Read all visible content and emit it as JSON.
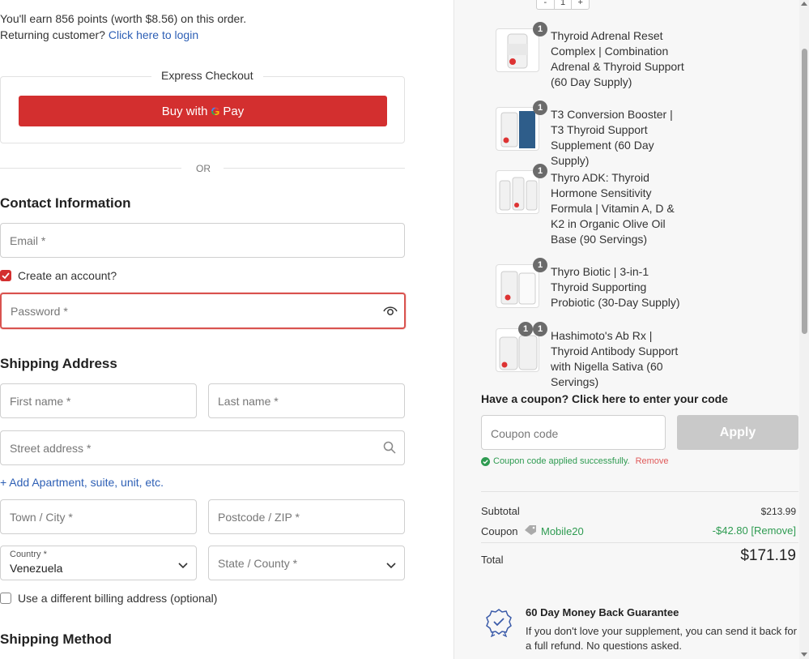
{
  "notices": {
    "points": "You'll earn 856 points (worth $8.56) on this order.",
    "returning_prefix": "Returning customer?",
    "login_link": "Click here to login"
  },
  "express": {
    "title": "Express Checkout",
    "button_prefix": "Buy with",
    "g": "G",
    "pay": "Pay",
    "or": "OR"
  },
  "contact": {
    "title": "Contact Information",
    "email_placeholder": "Email *",
    "create_account_label": "Create an account?",
    "password_placeholder": "Password *"
  },
  "shipping": {
    "title": "Shipping Address",
    "first_name_placeholder": "First name *",
    "last_name_placeholder": "Last name *",
    "street_placeholder": "Street address *",
    "add_apartment": "+ Add Apartment, suite, unit, etc.",
    "city_placeholder": "Town / City *",
    "postcode_placeholder": "Postcode / ZIP *",
    "country_label": "Country *",
    "country_value": "Venezuela",
    "state_placeholder": "State / County *",
    "billing_label": "Use a different billing address (optional)",
    "method_title": "Shipping Method"
  },
  "cart": {
    "qty": {
      "minus": "-",
      "value": "1",
      "plus": "+"
    },
    "items": [
      {
        "qty": "1",
        "name": "Thyroid Adrenal Reset Complex | Combination Adrenal & Thyroid Support (60 Day Supply)"
      },
      {
        "qty": "1",
        "name": "T3 Conversion Booster | T3 Thyroid Support Supplement (60 Day Supply)"
      },
      {
        "qty": "1",
        "name": "Thyro ADK: Thyroid Hormone Sensitivity Formula | Vitamin A, D & K2 in Organic Olive Oil Base (90 Servings)"
      },
      {
        "qty": "1",
        "name": "Thyro Biotic | 3-in-1 Thyroid Supporting Probiotic (30-Day Supply)"
      },
      {
        "qty": "1",
        "name": "Hashimoto's Ab Rx | Thyroid Antibody Support with Nigella Sativa (60 Servings)"
      }
    ]
  },
  "coupon": {
    "title": "Have a coupon? Click here to enter your code",
    "placeholder": "Coupon code",
    "apply": "Apply",
    "success": "Coupon code applied successfully.",
    "remove": "Remove"
  },
  "summary": {
    "subtotal_label": "Subtotal",
    "subtotal_value": "$213.99",
    "coupon_label": "Coupon",
    "coupon_code": "Mobile20",
    "coupon_discount": "-$42.80 [Remove]",
    "total_label": "Total",
    "total_value": "$171.19"
  },
  "guarantee": {
    "title": "60 Day Money Back Guarantee",
    "text": "If you don't love your supplement, you can send it back for a full refund. No questions asked."
  },
  "colors": {
    "accent": "#d32f2f",
    "link": "#2d5fb5",
    "success": "#2e9b51"
  }
}
